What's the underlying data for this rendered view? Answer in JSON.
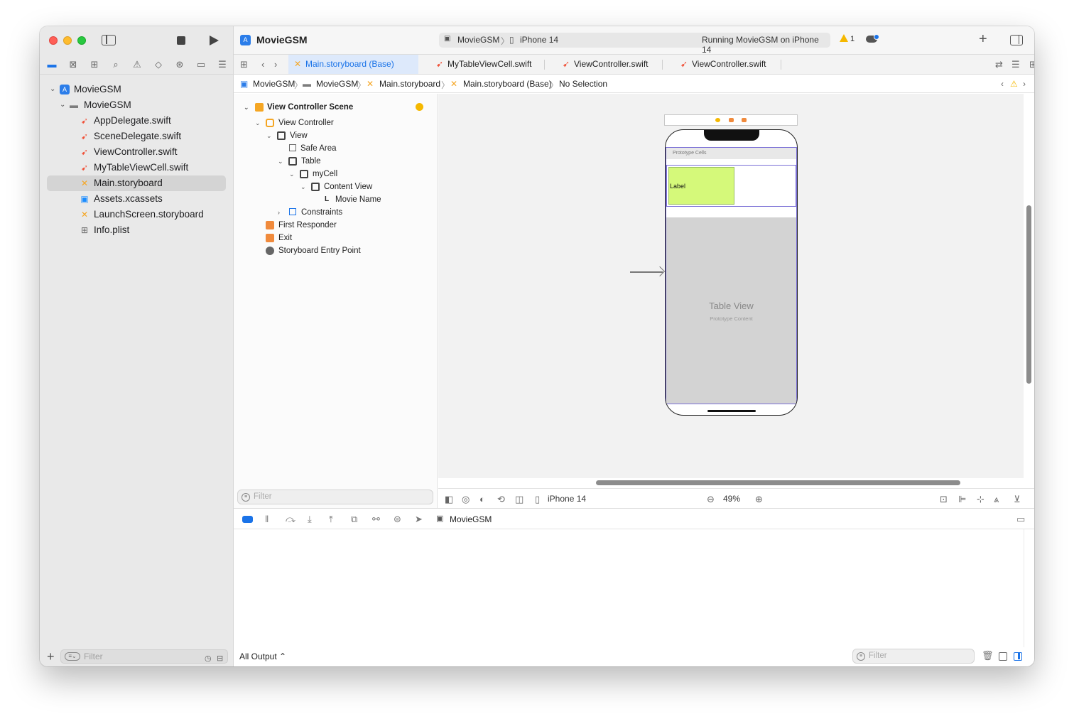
{
  "window": {
    "project_name": "MovieGSM"
  },
  "sidebar": {
    "items": [
      {
        "label": "MovieGSM",
        "kind": "project"
      },
      {
        "label": "MovieGSM",
        "kind": "folder"
      },
      {
        "label": "AppDelegate.swift",
        "kind": "swift"
      },
      {
        "label": "SceneDelegate.swift",
        "kind": "swift"
      },
      {
        "label": "ViewController.swift",
        "kind": "swift"
      },
      {
        "label": "MyTableViewCell.swift",
        "kind": "swift"
      },
      {
        "label": "Main.storyboard",
        "kind": "storyboard",
        "selected": true
      },
      {
        "label": "Assets.xcassets",
        "kind": "assets"
      },
      {
        "label": "LaunchScreen.storyboard",
        "kind": "storyboard"
      },
      {
        "label": "Info.plist",
        "kind": "plist"
      }
    ],
    "filter_placeholder": "Filter"
  },
  "toolbar": {
    "title": "MovieGSM",
    "scheme": "MovieGSM",
    "device": "iPhone 14",
    "status": "Running MovieGSM on iPhone 14",
    "warning_count": "1"
  },
  "tabs": [
    {
      "label": "Main.storyboard (Base)",
      "active": true
    },
    {
      "label": "MyTableViewCell.swift"
    },
    {
      "label": "ViewController.swift"
    },
    {
      "label": "ViewController.swift"
    }
  ],
  "jumpbar": {
    "crumbs": [
      "MovieGSM",
      "MovieGSM",
      "Main.storyboard",
      "Main.storyboard (Base)",
      "No Selection"
    ]
  },
  "outline": {
    "scene": "View Controller Scene",
    "view_controller": "View Controller",
    "view": "View",
    "safe_area": "Safe Area",
    "table": "Table",
    "cell": "myCell",
    "content_view": "Content View",
    "label_item": "Movie Name",
    "constraints": "Constraints",
    "first_responder": "First Responder",
    "exit": "Exit",
    "entry_point": "Storyboard Entry Point",
    "filter_placeholder": "Filter"
  },
  "canvas": {
    "prototype_cells": "Prototype Cells",
    "cell_label": "Label",
    "table_view_title": "Table View",
    "table_view_sub": "Prototype Content"
  },
  "canvas_bar": {
    "device": "iPhone 14",
    "zoom": "49%"
  },
  "debug": {
    "target": "MovieGSM",
    "output_selector": "All Output ⌃",
    "filter_placeholder": "Filter"
  },
  "colors": {
    "accent": "#1a73e8",
    "swift_orange": "#f05138",
    "storyboard_yellow": "#f5a623",
    "cell_label_fill": "#d5f97a",
    "selection_outline": "#7a6fd6"
  }
}
